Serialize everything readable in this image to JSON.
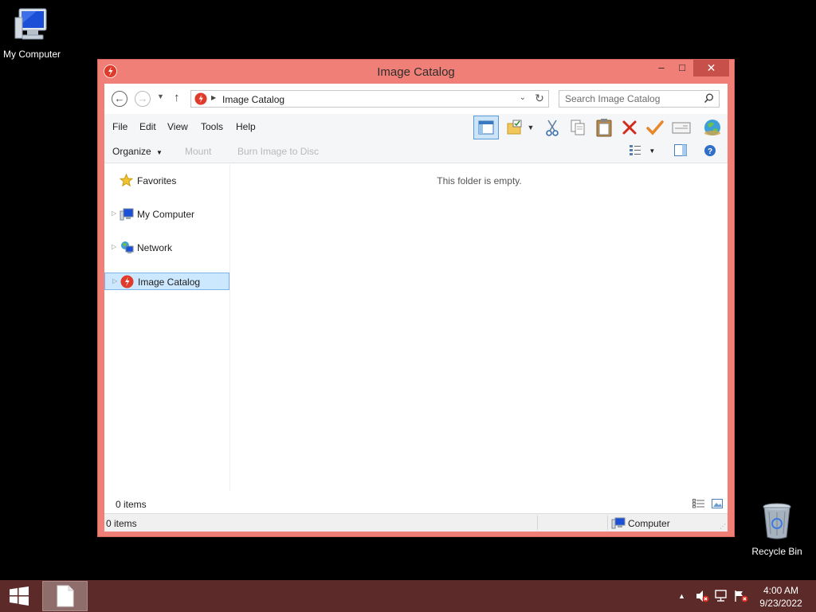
{
  "desktop": {
    "icons": [
      {
        "label": "My Computer",
        "icon": "computer-icon"
      },
      {
        "label": "Recycle Bin",
        "icon": "recycle-bin-icon"
      }
    ]
  },
  "window": {
    "title": "Image Catalog",
    "app_icon": "daemon-tools-icon",
    "accent_color": "#f08077",
    "controls": {
      "minimize": "–",
      "maximize": "□",
      "close": "✕"
    }
  },
  "address_bar": {
    "breadcrumb": [
      "Image Catalog"
    ],
    "search_placeholder": "Search Image Catalog"
  },
  "menu": {
    "items": [
      "File",
      "Edit",
      "View",
      "Tools",
      "Help"
    ]
  },
  "toolbar": {
    "icons": [
      "layout-pane-icon",
      "new-folder-icon",
      "dropdown-icon",
      "cut-icon",
      "copy-icon",
      "paste-icon",
      "delete-icon",
      "check-icon",
      "properties-icon",
      "globe-icon"
    ]
  },
  "command_bar": {
    "organize": "Organize",
    "mount": "Mount",
    "burn": "Burn Image to Disc"
  },
  "nav_pane": {
    "items": [
      {
        "label": "Favorites",
        "icon": "star-icon",
        "expandable": false,
        "selected": false
      },
      {
        "label": "My Computer",
        "icon": "computer-icon",
        "expandable": true,
        "selected": false
      },
      {
        "label": "Network",
        "icon": "network-icon",
        "expandable": true,
        "selected": false
      },
      {
        "label": "Image Catalog",
        "icon": "daemon-tools-icon",
        "expandable": true,
        "selected": true
      }
    ]
  },
  "content": {
    "empty_message": "This folder is empty."
  },
  "details_bar": {
    "count": "0 items"
  },
  "status_bar": {
    "count": "0 items",
    "zone": "Computer"
  },
  "taskbar": {
    "time": "4:00 AM",
    "date": "9/23/2022",
    "color": "#5c2a28"
  }
}
